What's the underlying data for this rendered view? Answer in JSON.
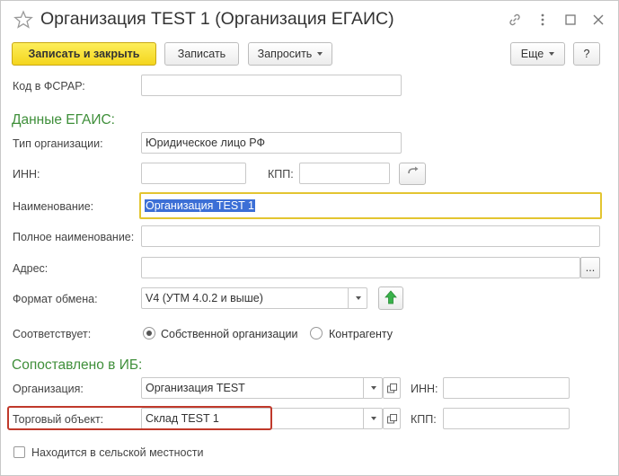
{
  "window": {
    "title": "Организация TEST 1 (Организация ЕГАИС)"
  },
  "toolbar": {
    "save_close_label": "Записать и закрыть",
    "save_label": "Записать",
    "request_label": "Запросить",
    "more_label": "Еще",
    "help_label": "?"
  },
  "fields": {
    "fsrar_code_label": "Код в ФСРАР:",
    "fsrar_code_value": ""
  },
  "egais": {
    "section_title": "Данные ЕГАИС:",
    "org_type_label": "Тип организации:",
    "org_type_value": "Юридическое лицо РФ",
    "inn_label": "ИНН:",
    "inn_value": "",
    "kpp_label": "КПП:",
    "kpp_value": "",
    "name_label": "Наименование:",
    "name_value": "Организация TEST 1",
    "full_name_label": "Полное наименование:",
    "full_name_value": "",
    "address_label": "Адрес:",
    "address_value": "",
    "address_button": "...",
    "format_label": "Формат обмена:",
    "format_value": "V4 (УТМ 4.0.2 и выше)",
    "corresponds_label": "Соответствует:",
    "radio_own": "Собственной организации",
    "radio_counterparty": "Контрагенту",
    "selected": "own"
  },
  "mapped": {
    "section_title": "Сопоставлено в ИБ:",
    "organization_label": "Организация:",
    "organization_value": "Организация TEST",
    "org_inn_label": "ИНН:",
    "org_inn_value": "",
    "trade_object_label": "Торговый объект:",
    "trade_object_value": "Склад TEST 1",
    "trade_kpp_label": "КПП:",
    "trade_kpp_value": "",
    "rural_label": "Находится в сельской местности",
    "rural_checked": false
  },
  "colors": {
    "accent_green": "#3f8f3a",
    "primary_yellow": "#f4d51d",
    "highlight_red": "#c0392b",
    "selection_blue": "#3c6fd6"
  },
  "icons": [
    "star-icon",
    "link-icon",
    "more-vert-icon",
    "maximize-icon",
    "close-icon",
    "refresh-icon",
    "upload-arrow-icon",
    "open-icon"
  ]
}
